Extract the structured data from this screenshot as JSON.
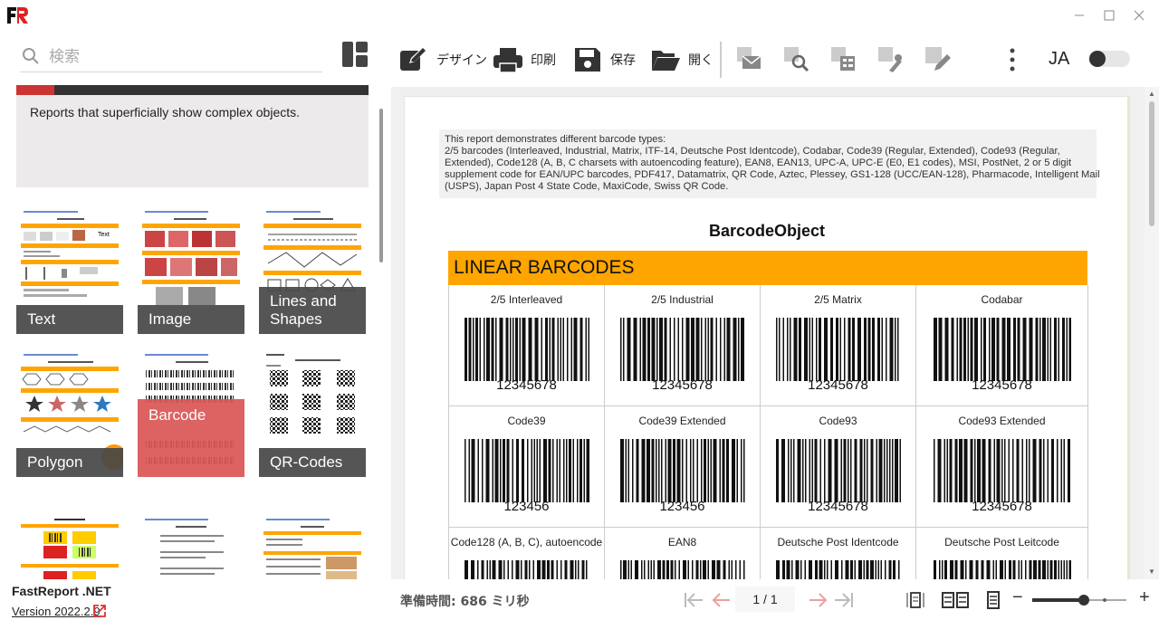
{
  "search": {
    "placeholder": "検索"
  },
  "description": "Reports that superficially show complex objects.",
  "thumbnails": [
    {
      "label": "Text",
      "selected": false
    },
    {
      "label": "Image",
      "selected": false
    },
    {
      "label": "Lines and Shapes",
      "selected": false
    },
    {
      "label": "Polygon",
      "selected": false
    },
    {
      "label": "Barcode",
      "selected": true
    },
    {
      "label": "QR-Codes",
      "selected": false
    },
    {
      "label": "",
      "selected": false
    },
    {
      "label": "",
      "selected": false
    },
    {
      "label": "",
      "selected": false
    }
  ],
  "footer": {
    "product": "FastReport .NET",
    "version": "Version 2022.2.9"
  },
  "toolbar": {
    "design": "デザイン",
    "print": "印刷",
    "save": "保存",
    "open": "開く",
    "language": "JA"
  },
  "report": {
    "info_lines": [
      "This report demonstrates different barcode types:",
      "2/5 barcodes (Interleaved, Industrial, Matrix, ITF-14, Deutsche Post Identcode), Codabar, Code39 (Regular, Extended), Code93 (Regular,",
      "Extended), Code128 (A, B, C charsets with autoencoding feature), EAN8, EAN13, UPC-A, UPC-E (E0, E1 codes), MSI, PostNet, 2 or 5 digit",
      "supplement code for EAN/UPC barcodes, PDF417, Datamatrix, QR Code, Aztec, Plessey, GS1-128 (UCC/EAN-128), Pharmacode, Intelligent Mail",
      "(USPS), Japan Post 4 State Code, MaxiCode, Swiss QR Code."
    ],
    "title": "BarcodeObject",
    "section": "LINEAR BARCODES",
    "barcodes": [
      {
        "name": "2/5 Interleaved",
        "value": "12345678"
      },
      {
        "name": "2/5 Industrial",
        "value": "12345678"
      },
      {
        "name": "2/5 Matrix",
        "value": "12345678"
      },
      {
        "name": "Codabar",
        "value": "12345678"
      },
      {
        "name": "Code39",
        "value": "123456"
      },
      {
        "name": "Code39 Extended",
        "value": "123456"
      },
      {
        "name": "Code93",
        "value": "12345678"
      },
      {
        "name": "Code93 Extended",
        "value": "12345678"
      },
      {
        "name": "Code128 (A, B, C), autoencode",
        "value": ""
      },
      {
        "name": "EAN8",
        "value": ""
      },
      {
        "name": "Deutsche Post Identcode",
        "value": ""
      },
      {
        "name": "Deutsche Post Leitcode",
        "value": ""
      }
    ]
  },
  "status": {
    "prep_time": "準備時間: 686 ミリ秒",
    "page": "1 / 1",
    "zoom_level": 0.55
  }
}
